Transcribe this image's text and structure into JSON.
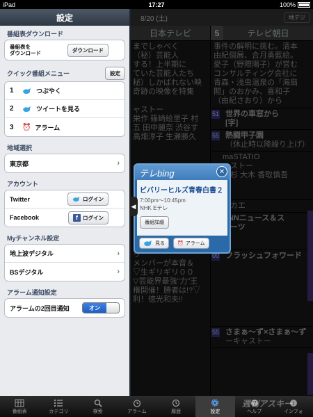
{
  "status_bar": {
    "carrier": "iPad",
    "time": "17:27",
    "battery": "100%"
  },
  "background": {
    "date": "8/20 (土)",
    "chip": "地デジ",
    "channel_a": "日本テレビ",
    "channel_b_num": "5",
    "channel_b": "テレビ朝日",
    "col_a_text": "までしゃべく\n（秘）芸能人\nする！上半期に\nていた芸能人たち\n秘）しかばれない映\n奇跡の映像を特集\n\nャストー\n栄作 篠崎絵里子 村\n五 田中麗奈 渋谷す\n高畑淳子 生瀬勝久",
    "col_a_text2": "\n\n\n\n\n\n\n\n\n\nか＆奇跡の映像を\n出▽徹底検証！しゃり\nメンバーが本音＆\n▽生ギリギリ００\n▽芸能界最強\"力\"王\n権開催！勝者は!?▽\n利！徳光和夫!!",
    "col_b_top": "事件の解明に挑む。清本\n由紀個展、合月勇藍絵。\n愛子（野際陽子）が営む\nコンサルティング会社に\n青森・浅虫温泉の「海扇\n閣」のおかみ、喜和子\n（由紀さおり）から",
    "b1_num": "51",
    "b1_text": "世界の車窓から\n[字]",
    "b2_num": "55",
    "b2_text": "熱闘甲子園",
    "b2_sub": "（休止時以降繰り上げ）",
    "b3_text": "maSTATIO\nャストー\n大杉 大木 香取慎吾",
    "b4_text": "ゼカエ",
    "b5_text": "ANNニュース＆ス\nポーツ",
    "b6_num": "00",
    "b6_text": "フラッシュフォワード",
    "b7_num": "55",
    "b7_text": "さまぁ～ず×さまぁ～ず",
    "b7_sub": "ーキャストー"
  },
  "panel": {
    "title": "設定",
    "download": {
      "header": "番組表ダウンロード",
      "label": "番組表を\nダウンロード",
      "button": "ダウンロード"
    },
    "quick": {
      "header": "クイック番組メニュー",
      "settings_button": "設定",
      "items": [
        {
          "index": "1",
          "label": "つぶやく"
        },
        {
          "index": "2",
          "label": "ツイートを見る"
        },
        {
          "index": "3",
          "label": "アラーム"
        }
      ]
    },
    "region": {
      "header": "地域選択",
      "value": "東京都"
    },
    "account": {
      "header": "アカウント",
      "twitter_label": "Twitter",
      "twitter_button": "ログイン",
      "facebook_label": "Facebook",
      "facebook_button": "ログイン"
    },
    "mychannel": {
      "header": "Myチャンネル設定",
      "items": [
        "地上波デジタル",
        "BSデジタル"
      ]
    },
    "alarm": {
      "header": "アラーム通知設定",
      "label": "アラームの2回目通知",
      "toggle_on": "オン"
    }
  },
  "popup": {
    "logo": "テレbing",
    "title": "ビバリーヒルズ青春白書２",
    "time": "7:00pm〜10:45pm",
    "channel": "NHK Eテレ",
    "detail_button": "番組詳細",
    "watch_button": "見る",
    "alarm_button": "アラーム"
  },
  "tabbar": {
    "tabs": [
      {
        "label": "番組表",
        "icon": "grid-icon"
      },
      {
        "label": "カテゴリ",
        "icon": "list-icon"
      },
      {
        "label": "検索",
        "icon": "search-icon"
      },
      {
        "label": "アラーム",
        "icon": "alarm-clock-icon"
      },
      {
        "label": "履歴",
        "icon": "history-icon"
      },
      {
        "label": "設定",
        "icon": "gear-icon"
      },
      {
        "label": "ヘルプ",
        "icon": "help-icon"
      },
      {
        "label": "インフォ",
        "icon": "info-icon"
      }
    ],
    "active_tab": "設定",
    "watermark": "週刊アスキー"
  }
}
